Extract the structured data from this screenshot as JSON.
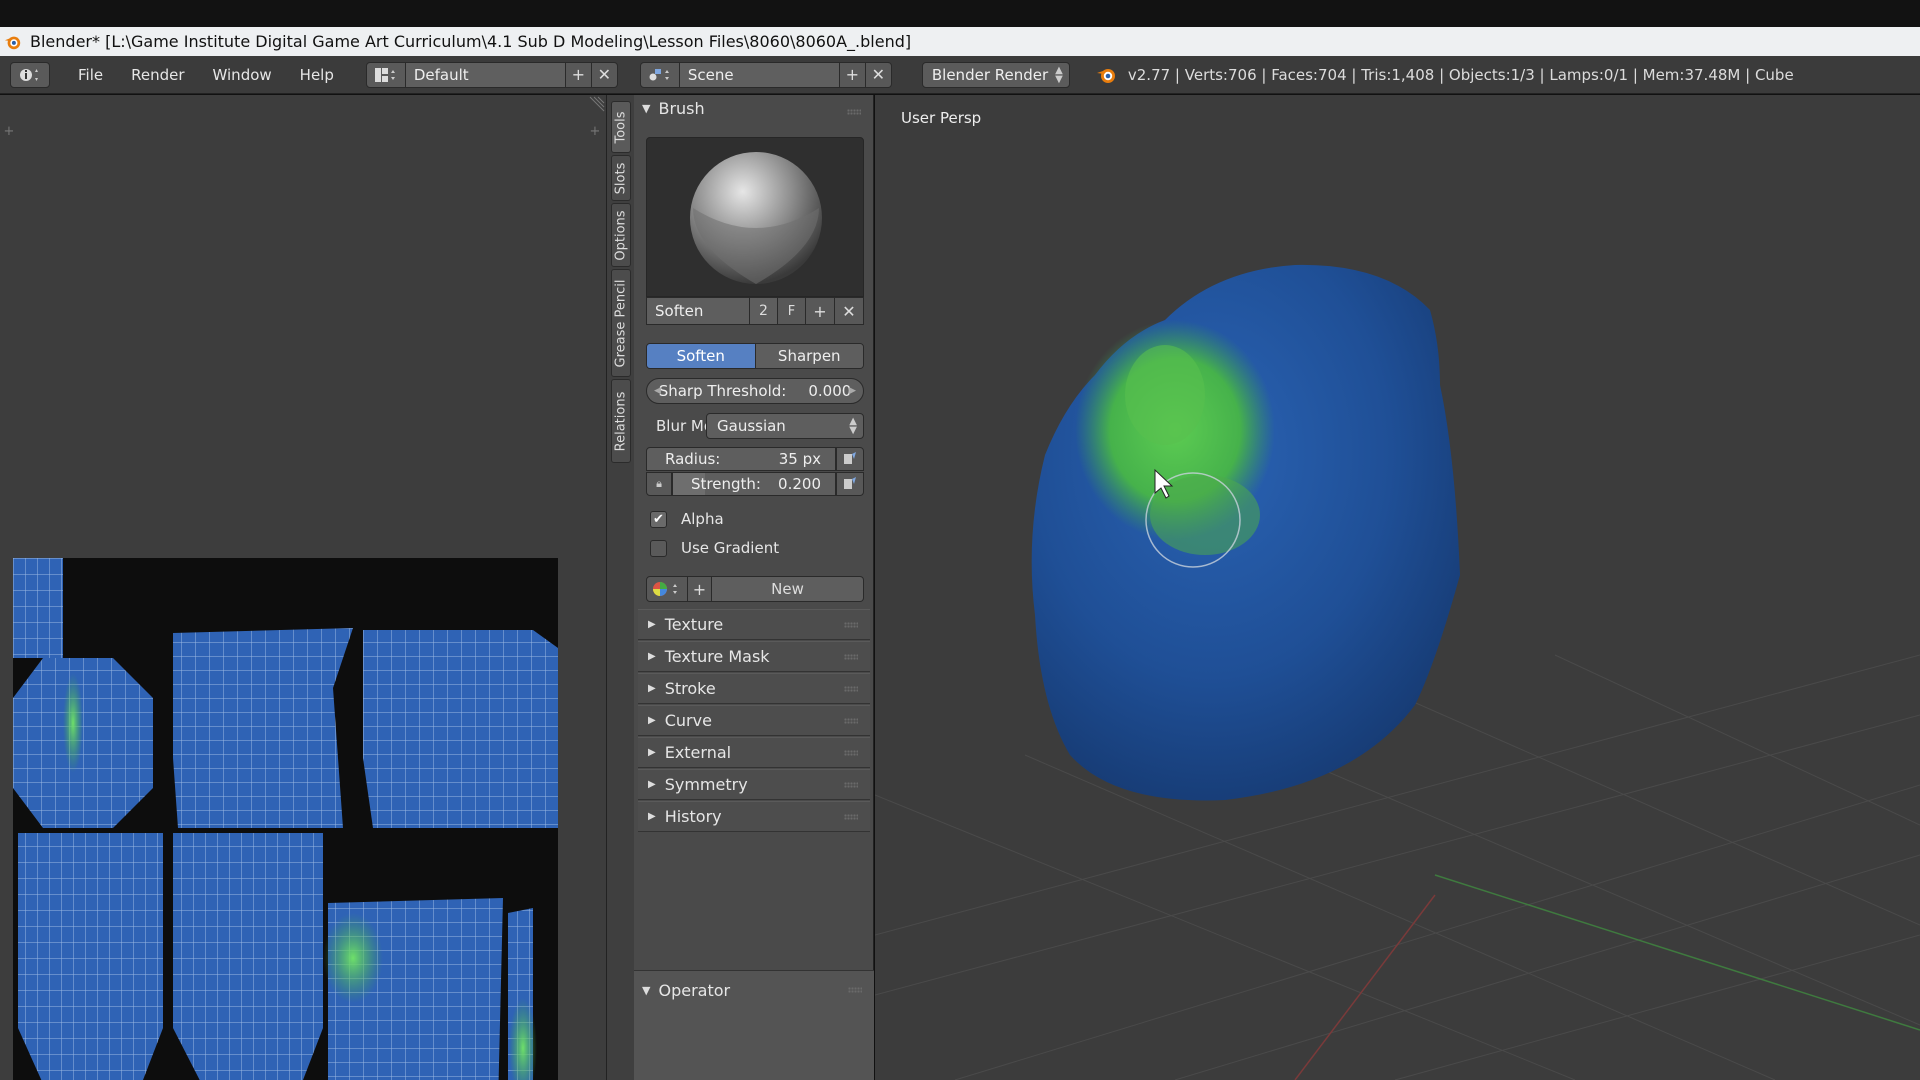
{
  "window": {
    "title": "Blender* [L:\\Game Institute Digital Game Art  Curriculum\\4.1 Sub D Modeling\\Lesson Files\\8060\\8060A_.blend]"
  },
  "header": {
    "menus": [
      "File",
      "Render",
      "Window",
      "Help"
    ],
    "layout": "Default",
    "scene": "Scene",
    "render_engine": "Blender Render",
    "stats": "v2.77 | Verts:706 | Faces:704 | Tris:1,408 | Objects:1/3 | Lamps:0/1 | Mem:37.48M | Cube"
  },
  "tool_tabs": [
    "Tools",
    "Slots",
    "Options",
    "Grease Pencil",
    "Relations"
  ],
  "brush_panel": {
    "title": "Brush",
    "brush_name": "Soften",
    "users": "2",
    "fake_user": "F",
    "mode_soften": "Soften",
    "mode_sharpen": "Sharpen",
    "sharp_threshold_label": "Sharp Threshold:",
    "sharp_threshold_value": "0.000",
    "blur_mode_label": "Blur Mode",
    "blur_mode_value": "Gaussian",
    "radius_label": "Radius:",
    "radius_value": "35 px",
    "strength_label": "Strength:",
    "strength_value": "0.200",
    "strength_fraction": 0.2,
    "alpha_label": "Alpha",
    "alpha_checked": true,
    "use_gradient_label": "Use Gradient",
    "use_gradient_checked": false,
    "new_texture_label": "New"
  },
  "collapsed_panels": [
    "Texture",
    "Texture Mask",
    "Stroke",
    "Curve",
    "External",
    "Symmetry",
    "History"
  ],
  "operator_panel": {
    "title": "Operator"
  },
  "viewport": {
    "label": "User Persp"
  },
  "colors": {
    "accent_blue": "#5680c2",
    "mesh_blue": "#1f4f96",
    "paint_green": "#4fc04a"
  }
}
